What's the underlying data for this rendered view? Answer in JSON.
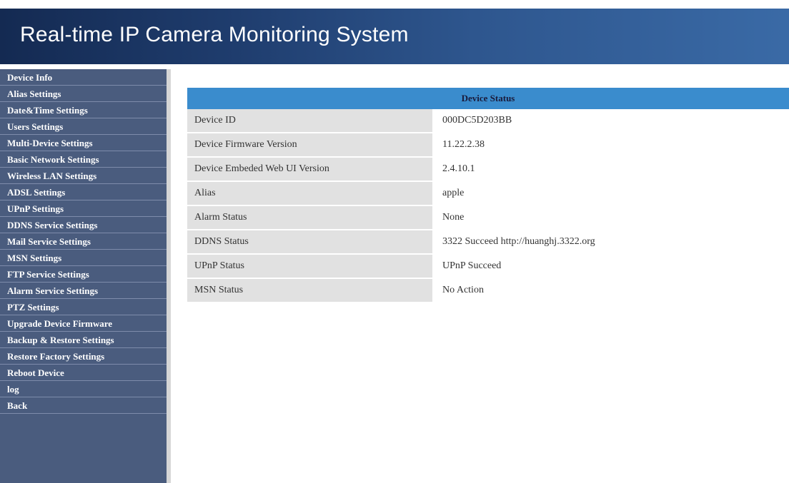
{
  "header": {
    "title": "Real-time IP Camera Monitoring System"
  },
  "sidebar": {
    "items": [
      {
        "label": "Device Info"
      },
      {
        "label": "Alias Settings"
      },
      {
        "label": "Date&Time Settings"
      },
      {
        "label": "Users Settings"
      },
      {
        "label": "Multi-Device Settings"
      },
      {
        "label": "Basic Network Settings"
      },
      {
        "label": "Wireless LAN Settings"
      },
      {
        "label": "ADSL Settings"
      },
      {
        "label": "UPnP Settings"
      },
      {
        "label": "DDNS Service Settings"
      },
      {
        "label": "Mail Service Settings"
      },
      {
        "label": "MSN Settings"
      },
      {
        "label": "FTP Service Settings"
      },
      {
        "label": "Alarm Service Settings"
      },
      {
        "label": "PTZ Settings"
      },
      {
        "label": "Upgrade Device Firmware"
      },
      {
        "label": "Backup & Restore Settings"
      },
      {
        "label": "Restore Factory Settings"
      },
      {
        "label": "Reboot Device"
      },
      {
        "label": "log"
      },
      {
        "label": "Back"
      }
    ]
  },
  "device_status": {
    "title": "Device Status",
    "rows": [
      {
        "label": "Device ID",
        "value": "000DC5D203BB"
      },
      {
        "label": "Device Firmware Version",
        "value": "11.22.2.38"
      },
      {
        "label": "Device Embeded Web UI Version",
        "value": "2.4.10.1"
      },
      {
        "label": "Alias",
        "value": "apple"
      },
      {
        "label": "Alarm Status",
        "value": "None"
      },
      {
        "label": "DDNS Status",
        "value": "3322 Succeed  http://huanghj.3322.org"
      },
      {
        "label": "UPnP Status",
        "value": "UPnP Succeed"
      },
      {
        "label": "MSN Status",
        "value": "No Action"
      }
    ]
  },
  "colors": {
    "header_bg": "#1f3d6e",
    "sidebar_bg": "#4a5c7e",
    "table_header_bg": "#3a8ccd",
    "label_cell_bg": "#e1e1e1"
  }
}
